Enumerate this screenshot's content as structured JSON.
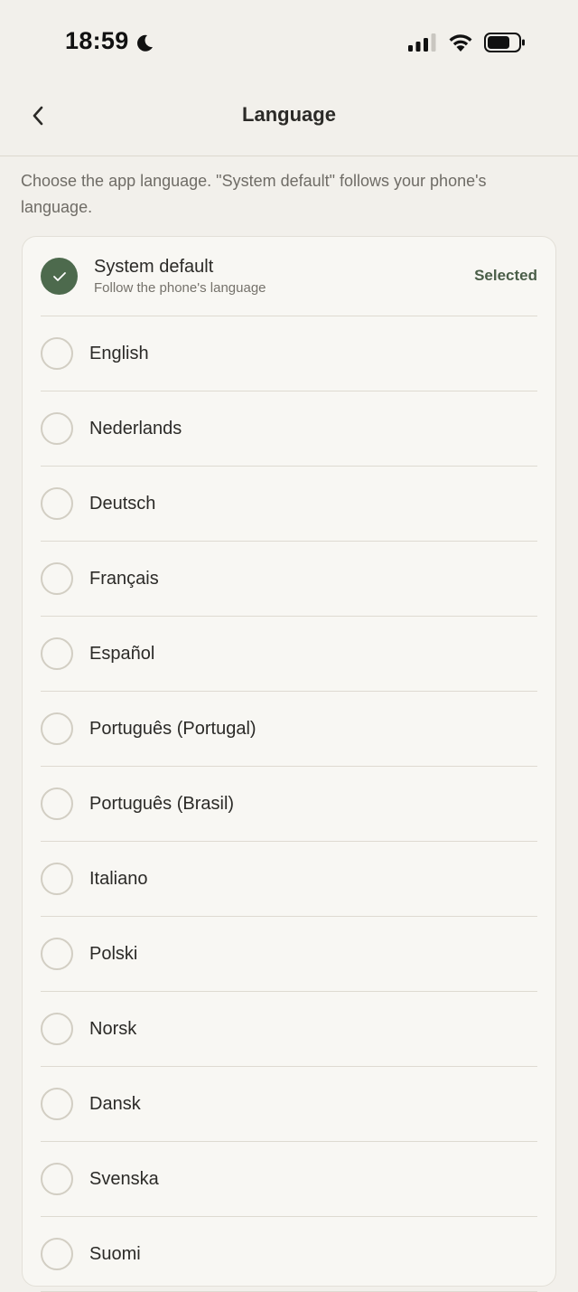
{
  "status_bar": {
    "time": "18:59"
  },
  "nav": {
    "title": "Language"
  },
  "description": "Choose the app language. \"System default\" follows your phone's language.",
  "languages": [
    {
      "label": "System default",
      "sublabel": "Follow the phone's language",
      "selected": true,
      "badge": "Selected"
    },
    {
      "label": "English",
      "selected": false
    },
    {
      "label": "Nederlands",
      "selected": false
    },
    {
      "label": "Deutsch",
      "selected": false
    },
    {
      "label": "Français",
      "selected": false
    },
    {
      "label": "Español",
      "selected": false
    },
    {
      "label": "Português (Portugal)",
      "selected": false
    },
    {
      "label": "Português (Brasil)",
      "selected": false
    },
    {
      "label": "Italiano",
      "selected": false
    },
    {
      "label": "Polski",
      "selected": false
    },
    {
      "label": "Norsk",
      "selected": false
    },
    {
      "label": "Dansk",
      "selected": false
    },
    {
      "label": "Svenska",
      "selected": false
    },
    {
      "label": "Suomi",
      "selected": false
    }
  ],
  "colors": {
    "background": "#f2f0eb",
    "card": "#f8f7f3",
    "accent": "#4d6a4d",
    "selected_text": "#4a5e48"
  },
  "icons": {
    "back": "chevron-left-icon",
    "check": "checkmark-icon",
    "do_not_disturb": "moon-icon",
    "signal": "cellular-signal-icon",
    "wifi": "wifi-icon",
    "battery": "battery-icon"
  }
}
